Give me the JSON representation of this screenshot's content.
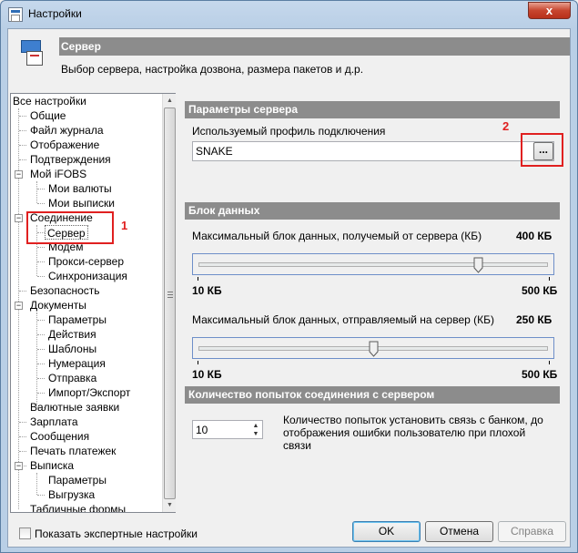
{
  "window": {
    "title": "Настройки",
    "close_glyph": "x"
  },
  "header": {
    "title": "Сервер",
    "description": "Выбор сервера, настройка дозвона, размера пакетов и д.р.",
    "icon": "settings-server-icon"
  },
  "tree": {
    "items": [
      {
        "label": "Все настройки"
      },
      {
        "label": "Общие"
      },
      {
        "label": "Файл журнала"
      },
      {
        "label": "Отображение"
      },
      {
        "label": "Подтверждения"
      },
      {
        "label": "Мой iFOBS"
      },
      {
        "label": "Мои валюты"
      },
      {
        "label": "Мои выписки"
      },
      {
        "label": "Соединение"
      },
      {
        "label": "Сервер"
      },
      {
        "label": "Модем"
      },
      {
        "label": "Прокси-сервер"
      },
      {
        "label": "Синхронизация"
      },
      {
        "label": "Безопасность"
      },
      {
        "label": "Документы"
      },
      {
        "label": "Параметры"
      },
      {
        "label": "Действия"
      },
      {
        "label": "Шаблоны"
      },
      {
        "label": "Нумерация"
      },
      {
        "label": "Отправка"
      },
      {
        "label": "Импорт/Экспорт"
      },
      {
        "label": "Валютные заявки"
      },
      {
        "label": "Зарплата"
      },
      {
        "label": "Сообщения"
      },
      {
        "label": "Печать платежек"
      },
      {
        "label": "Выписка"
      },
      {
        "label": "Параметры"
      },
      {
        "label": "Выгрузка"
      },
      {
        "label": "Табличные формы"
      }
    ],
    "minus_glyph": "−"
  },
  "server_params": {
    "section_title": "Параметры сервера",
    "profile_label": "Используемый профиль подключения",
    "profile_value": "SNAKE",
    "browse_label": "..."
  },
  "data_block": {
    "section_title": "Блок данных",
    "receive_label": "Максимальный блок данных, получемый от сервера (КБ)",
    "receive_value": "400 КБ",
    "receive_fraction": 0.8,
    "receive_min": "10 КБ",
    "receive_max": "500 КБ",
    "send_label": "Максимальный блок данных, отправляемый на сервер (КБ)",
    "send_value": "250 КБ",
    "send_fraction": 0.5,
    "send_min": "10 КБ",
    "send_max": "500 КБ"
  },
  "retries": {
    "section_title": "Количество попыток соединения с сервером",
    "value": "10",
    "description_line1": "Количество попыток установить связь с банком, до",
    "description_line2": "отображения ошибки пользователю при плохой",
    "description_line3": "связи"
  },
  "footer": {
    "expert_label": "Показать экспертные настройки",
    "ok_label": "OK",
    "cancel_label": "Отмена",
    "help_label": "Справка"
  },
  "annotations": {
    "one": "1",
    "two": "2",
    "color": "#e02020"
  }
}
